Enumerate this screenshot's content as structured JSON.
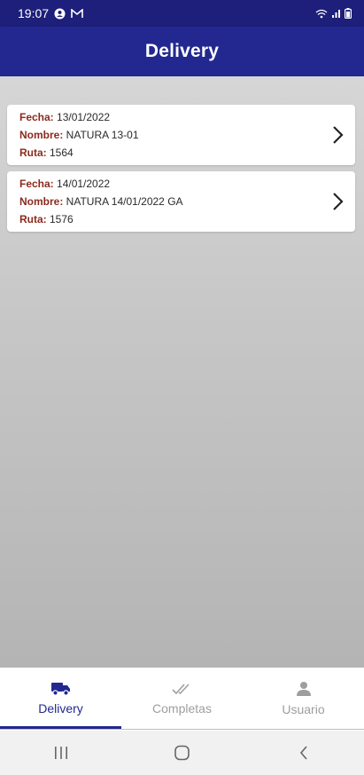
{
  "status_bar": {
    "time": "19:07",
    "icons_left": [
      "account-icon",
      "gmail-icon"
    ],
    "icons_right": [
      "wifi-icon",
      "signal-icon",
      "battery-icon"
    ]
  },
  "app_bar": {
    "title": "Delivery"
  },
  "deliveries": [
    {
      "fecha_label": "Fecha:",
      "fecha": " 13/01/2022",
      "nombre_label": "Nombre:",
      "nombre": " NATURA 13-01",
      "ruta_label": "Ruta:",
      "ruta": " 1564"
    },
    {
      "fecha_label": "Fecha:",
      "fecha": " 14/01/2022",
      "nombre_label": "Nombre:",
      "nombre": " NATURA 14/01/2022 GA",
      "ruta_label": "Ruta:",
      "ruta": " 1576"
    }
  ],
  "tabs": [
    {
      "label": "Delivery",
      "icon": "truck-icon",
      "active": true
    },
    {
      "label": "Completas",
      "icon": "double-check-icon",
      "active": false
    },
    {
      "label": "Usuario",
      "icon": "user-icon",
      "active": false
    }
  ],
  "colors": {
    "primary": "#22288f",
    "status_bar": "#1d1f7a",
    "field_label": "#8b2a1e",
    "inactive": "#9e9e9e"
  }
}
